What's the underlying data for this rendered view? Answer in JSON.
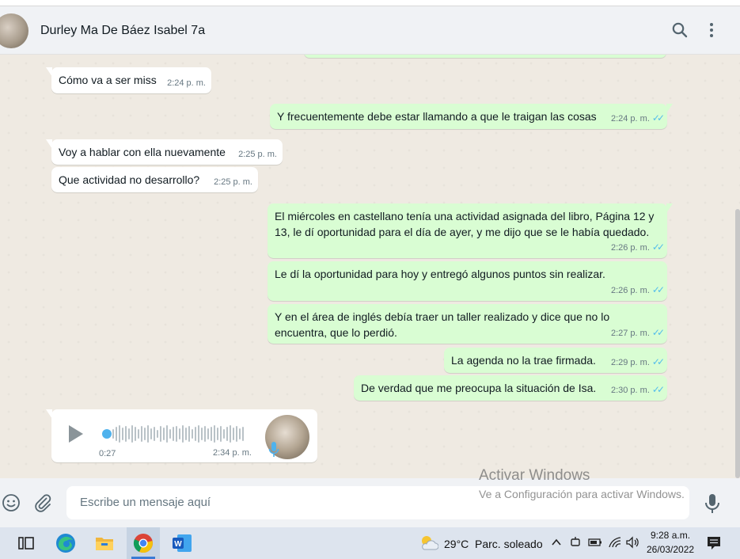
{
  "header": {
    "contact_name": "Durley Ma De Báez Isabel 7a"
  },
  "messages": [
    {
      "dir": "in",
      "text": "Cómo va a ser miss",
      "time": "2:24 p. m."
    },
    {
      "dir": "out",
      "text": "Y frecuentemente debe estar llamando a que le traigan las cosas",
      "time": "2:24 p. m."
    },
    {
      "dir": "in",
      "text": "Voy a hablar con ella nuevamente",
      "time": "2:25 p. m."
    },
    {
      "dir": "in",
      "text": "Que actividad no desarrollo?",
      "time": "2:25 p. m."
    },
    {
      "dir": "out",
      "text": "El miércoles en castellano tenía una actividad asignada del libro, Página 12 y 13, le dí oportunidad para el día de ayer, y me dijo que se le había quedado.",
      "time": "2:26 p. m."
    },
    {
      "dir": "out",
      "text": "Le dí la oportunidad para hoy y entregó algunos puntos sin realizar.",
      "time": "2:26 p. m."
    },
    {
      "dir": "out",
      "text": "Y en el área de inglés debía traer un taller realizado y dice que no lo encuentra, que lo perdió.",
      "time": "2:27 p. m."
    },
    {
      "dir": "out",
      "text": "La agenda no la trae firmada.",
      "time": "2:29 p. m."
    },
    {
      "dir": "out",
      "text": "De verdad que me preocupa la situación de Isa.",
      "time": "2:30 p. m."
    }
  ],
  "voice_note": {
    "duration": "0:27",
    "time": "2:34 p. m.",
    "progress": 0
  },
  "composer": {
    "placeholder": "Escribe un mensaje aquí"
  },
  "watermark": {
    "title": "Activar Windows",
    "subtitle": "Ve a Configuración para activar Windows."
  },
  "taskbar": {
    "weather_temp": "29°C",
    "weather_desc": "Parc. soleado",
    "time": "9:28 a.m.",
    "date": "26/03/2022",
    "apps": [
      "task-view-icon",
      "edge-icon",
      "file-explorer-icon",
      "chrome-icon",
      "word-icon"
    ]
  },
  "colors": {
    "incoming": "#ffffff",
    "outgoing": "#d9fdd3",
    "read_ticks": "#53bdeb",
    "chat_bg": "#efeae2"
  }
}
